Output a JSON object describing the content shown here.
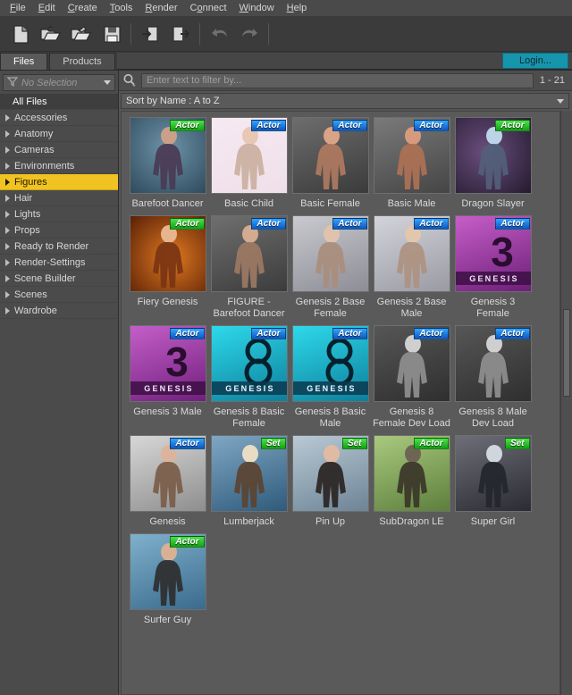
{
  "menubar": {
    "items": [
      {
        "label": "File",
        "mnemonic": "F"
      },
      {
        "label": "Edit",
        "mnemonic": "E"
      },
      {
        "label": "Create",
        "mnemonic": "C"
      },
      {
        "label": "Tools",
        "mnemonic": "T"
      },
      {
        "label": "Render",
        "mnemonic": "R"
      },
      {
        "label": "Connect",
        "mnemonic": "o"
      },
      {
        "label": "Window",
        "mnemonic": "W"
      },
      {
        "label": "Help",
        "mnemonic": "H"
      }
    ]
  },
  "toolbar": {
    "buttons": [
      {
        "icon": "new-file-icon",
        "disabled": false
      },
      {
        "icon": "open-folder-icon",
        "disabled": false
      },
      {
        "icon": "open-recent-folder-icon",
        "disabled": false
      },
      {
        "icon": "save-icon",
        "disabled": false
      },
      {
        "icon": "import-icon",
        "disabled": false
      },
      {
        "icon": "export-icon",
        "disabled": false
      },
      {
        "icon": "undo-icon",
        "disabled": true
      },
      {
        "icon": "redo-icon",
        "disabled": true
      }
    ]
  },
  "tabs": {
    "items": [
      {
        "label": "Files",
        "active": true
      },
      {
        "label": "Products",
        "active": false
      }
    ],
    "login_label": "Login..."
  },
  "sidebar": {
    "selector": {
      "value": "No Selection",
      "icon": "filter-funnel-icon"
    },
    "all_files_label": "All Files",
    "items": [
      {
        "label": "Accessories"
      },
      {
        "label": "Anatomy"
      },
      {
        "label": "Cameras"
      },
      {
        "label": "Environments"
      },
      {
        "label": "Figures",
        "selected": true
      },
      {
        "label": "Hair"
      },
      {
        "label": "Lights"
      },
      {
        "label": "Props"
      },
      {
        "label": "Ready to Render"
      },
      {
        "label": "Render-Settings"
      },
      {
        "label": "Scene Builder"
      },
      {
        "label": "Scenes"
      },
      {
        "label": "Wardrobe"
      }
    ]
  },
  "filterbar": {
    "placeholder": "Enter text to filter by...",
    "value": "",
    "count": "1 - 21",
    "search_icon": "magnifier-icon"
  },
  "sortbar": {
    "label": "Sort by Name : A to Z"
  },
  "colors": {
    "accent_selected": "#f0c322",
    "login_button": "#1795ad",
    "badge_actor_blue": "#1a6fd4",
    "badge_set_green": "#22cc22",
    "panel_bg": "#555555",
    "grid_bg": "#5a5a5a"
  },
  "grid": {
    "items": [
      {
        "name": "Barefoot Dancer",
        "badge": "Actor",
        "badge_color": "green",
        "thumb": "dancer"
      },
      {
        "name": "Basic Child",
        "badge": "Actor",
        "badge_color": "blue",
        "thumb": "child"
      },
      {
        "name": "Basic Female",
        "badge": "Actor",
        "badge_color": "blue",
        "thumb": "female"
      },
      {
        "name": "Basic Male",
        "badge": "Actor",
        "badge_color": "blue",
        "thumb": "male"
      },
      {
        "name": "Dragon Slayer",
        "badge": "Actor",
        "badge_color": "green",
        "thumb": "slayer"
      },
      {
        "name": "Fiery Genesis",
        "badge": "Actor",
        "badge_color": "green",
        "thumb": "fiery"
      },
      {
        "name": "FIGURE - Barefoot Dancer",
        "badge": "Actor",
        "badge_color": "blue",
        "thumb": "figdancer"
      },
      {
        "name": "Genesis 2 Base Female",
        "badge": "Actor",
        "badge_color": "blue",
        "thumb": "g2f"
      },
      {
        "name": "Genesis 2 Base Male",
        "badge": "Actor",
        "badge_color": "blue",
        "thumb": "g2m"
      },
      {
        "name": "Genesis 3 Female",
        "badge": "Actor",
        "badge_color": "blue",
        "thumb": "g3f"
      },
      {
        "name": "Genesis 3 Male",
        "badge": "Actor",
        "badge_color": "blue",
        "thumb": "g3m"
      },
      {
        "name": "Genesis 8 Basic Female",
        "badge": "Actor",
        "badge_color": "blue",
        "thumb": "g8f"
      },
      {
        "name": "Genesis 8 Basic Male",
        "badge": "Actor",
        "badge_color": "blue",
        "thumb": "g8m"
      },
      {
        "name": "Genesis 8 Female Dev Load",
        "badge": "Actor",
        "badge_color": "blue",
        "thumb": "devf"
      },
      {
        "name": "Genesis 8 Male Dev Load",
        "badge": "Actor",
        "badge_color": "blue",
        "thumb": "devm"
      },
      {
        "name": "Genesis",
        "badge": "Actor",
        "badge_color": "blue",
        "thumb": "genesis"
      },
      {
        "name": "Lumberjack",
        "badge": "Set",
        "badge_color": "green",
        "thumb": "lumber"
      },
      {
        "name": "Pin Up",
        "badge": "Set",
        "badge_color": "green",
        "thumb": "pinup"
      },
      {
        "name": "SubDragon LE",
        "badge": "Actor",
        "badge_color": "green",
        "thumb": "dragon"
      },
      {
        "name": "Super Girl",
        "badge": "Set",
        "badge_color": "green",
        "thumb": "supergirl"
      },
      {
        "name": "Surfer Guy",
        "badge": "Actor",
        "badge_color": "green",
        "thumb": "surfer"
      }
    ]
  }
}
